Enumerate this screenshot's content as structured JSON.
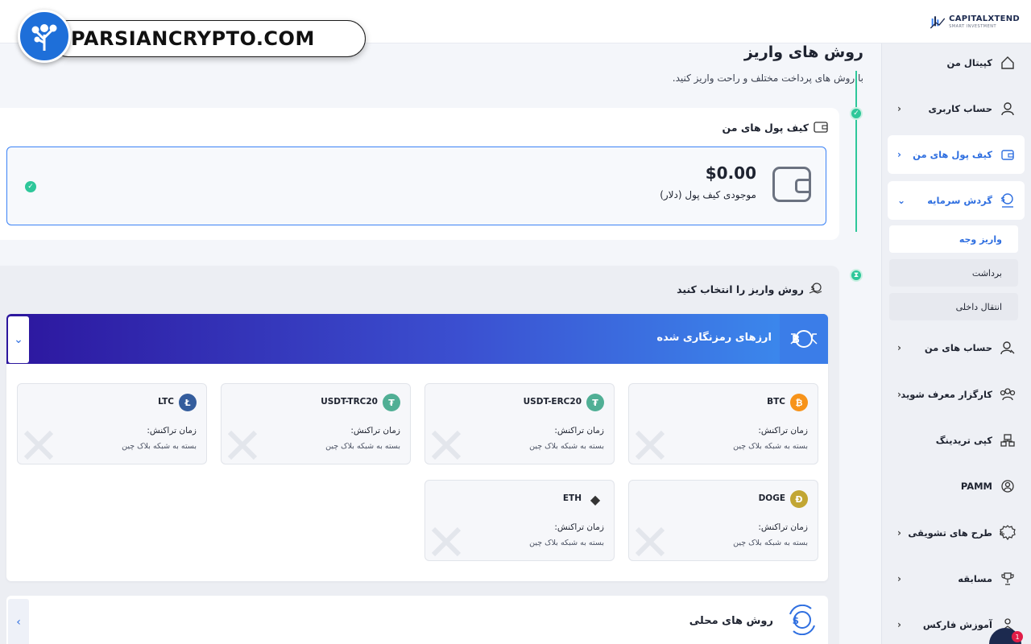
{
  "watermark": {
    "text": "PARSIANCRYPTO.COM"
  },
  "brand": {
    "name": "CAPITALXTEND",
    "tagline": "SMART INVESTMENT"
  },
  "sidebar": {
    "items": [
      {
        "label": "کپیتال من",
        "icon": "home-icon"
      },
      {
        "label": "حساب کاربری",
        "icon": "user-icon"
      },
      {
        "label": "کیف پول های من",
        "icon": "wallet-icon"
      },
      {
        "label": "گردش سرمایه",
        "icon": "money-flow-icon"
      },
      {
        "label": "حساب های من",
        "icon": "account-icon"
      },
      {
        "label": "کارگزار معرف شوید",
        "icon": "group-icon"
      },
      {
        "label": "کپی تریدینگ",
        "icon": "copy-trade-icon"
      },
      {
        "label": "PAMM",
        "icon": "pamm-icon"
      },
      {
        "label": "طرح های تشویقی",
        "icon": "discount-icon"
      },
      {
        "label": "مسابقه",
        "icon": "trophy-icon"
      },
      {
        "label": "آموزش فارکس",
        "icon": "education-icon"
      }
    ],
    "subitems": [
      {
        "label": "واریز وجه"
      },
      {
        "label": "برداشت"
      },
      {
        "label": "انتقال داخلی"
      }
    ]
  },
  "page": {
    "title": "روش های واریز",
    "subtitle": "با روش های پرداخت مختلف و راحت واریز کنید."
  },
  "wallet": {
    "header": "کیف پول های من",
    "amount": "$0.00",
    "label": "موجودی کیف پول (دلار)"
  },
  "deposit": {
    "header": "روش واریز را انتخاب کنید",
    "crypto_title": "ارزهای رمزنگاری شده",
    "local_title": "روش های محلی",
    "time_label": "زمان تراکنش:",
    "time_note": "بسته به شبکه بلاک چین",
    "coins": [
      {
        "name": "BTC",
        "symbol": "₿",
        "color": "#f7931a"
      },
      {
        "name": "USDT-ERC20",
        "symbol": "₮",
        "color": "#50af95"
      },
      {
        "name": "USDT-TRC20",
        "symbol": "₮",
        "color": "#50af95"
      },
      {
        "name": "LTC",
        "symbol": "Ł",
        "color": "#345d9d"
      },
      {
        "name": "DOGE",
        "symbol": "Ð",
        "color": "#c2a633"
      },
      {
        "name": "ETH",
        "symbol": "◆",
        "color": "#343434"
      }
    ]
  },
  "chat": {
    "count": "1"
  }
}
